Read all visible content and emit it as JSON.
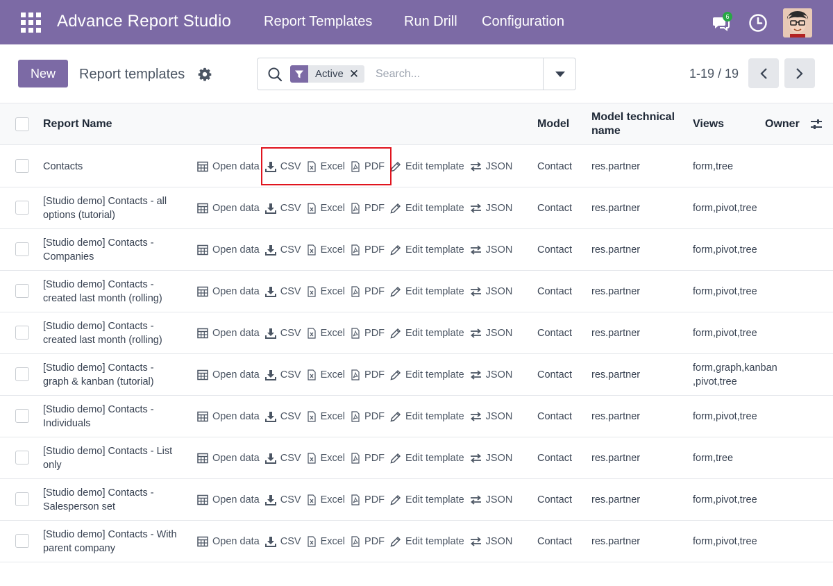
{
  "navbar": {
    "brand": "Advance Report Studio",
    "menu": [
      "Report Templates",
      "Run Drill",
      "Configuration"
    ],
    "chat_badge": "6",
    "apps_icon": "apps-grid-icon",
    "bg_color": "#7c6aa5"
  },
  "control_panel": {
    "new_label": "New",
    "breadcrumb": "Report templates",
    "search": {
      "facet_label": "Active",
      "placeholder": "Search..."
    },
    "pager": "1-19 / 19"
  },
  "table": {
    "columns": {
      "name": "Report Name",
      "model": "Model",
      "technical_name": "Model technical name",
      "views": "Views",
      "owner": "Owner"
    },
    "actions": {
      "open_data": "Open data",
      "csv": "CSV",
      "excel": "Excel",
      "pdf": "PDF",
      "edit_template": "Edit template",
      "json": "JSON"
    },
    "rows": [
      {
        "name": "Contacts",
        "model": "Contact",
        "technical_name": "res.partner",
        "views": "form,tree"
      },
      {
        "name": "[Studio demo] Contacts - all options (tutorial)",
        "model": "Contact",
        "technical_name": "res.partner",
        "views": "form,pivot,tree"
      },
      {
        "name": "[Studio demo] Contacts - Companies",
        "model": "Contact",
        "technical_name": "res.partner",
        "views": "form,pivot,tree"
      },
      {
        "name": "[Studio demo] Contacts - created last month (rolling)",
        "model": "Contact",
        "technical_name": "res.partner",
        "views": "form,pivot,tree"
      },
      {
        "name": "[Studio demo] Contacts - created last month (rolling)",
        "model": "Contact",
        "technical_name": "res.partner",
        "views": "form,pivot,tree"
      },
      {
        "name": " [Studio demo] Contacts - graph & kanban (tutorial)",
        "model": "Contact",
        "technical_name": "res.partner",
        "views": "form,graph,kanban ,pivot,tree"
      },
      {
        "name": "[Studio demo] Contacts - Individuals",
        "model": "Contact",
        "technical_name": "res.partner",
        "views": "form,pivot,tree"
      },
      {
        "name": "[Studio demo] Contacts - List only",
        "model": "Contact",
        "technical_name": "res.partner",
        "views": "form,tree"
      },
      {
        "name": "[Studio demo] Contacts - Salesperson set",
        "model": "Contact",
        "technical_name": "res.partner",
        "views": "form,pivot,tree"
      },
      {
        "name": "[Studio demo] Contacts - With parent company",
        "model": "Contact",
        "technical_name": "res.partner",
        "views": "form,pivot,tree"
      }
    ]
  },
  "annotation": {
    "highlight_color": "#e0141e"
  }
}
